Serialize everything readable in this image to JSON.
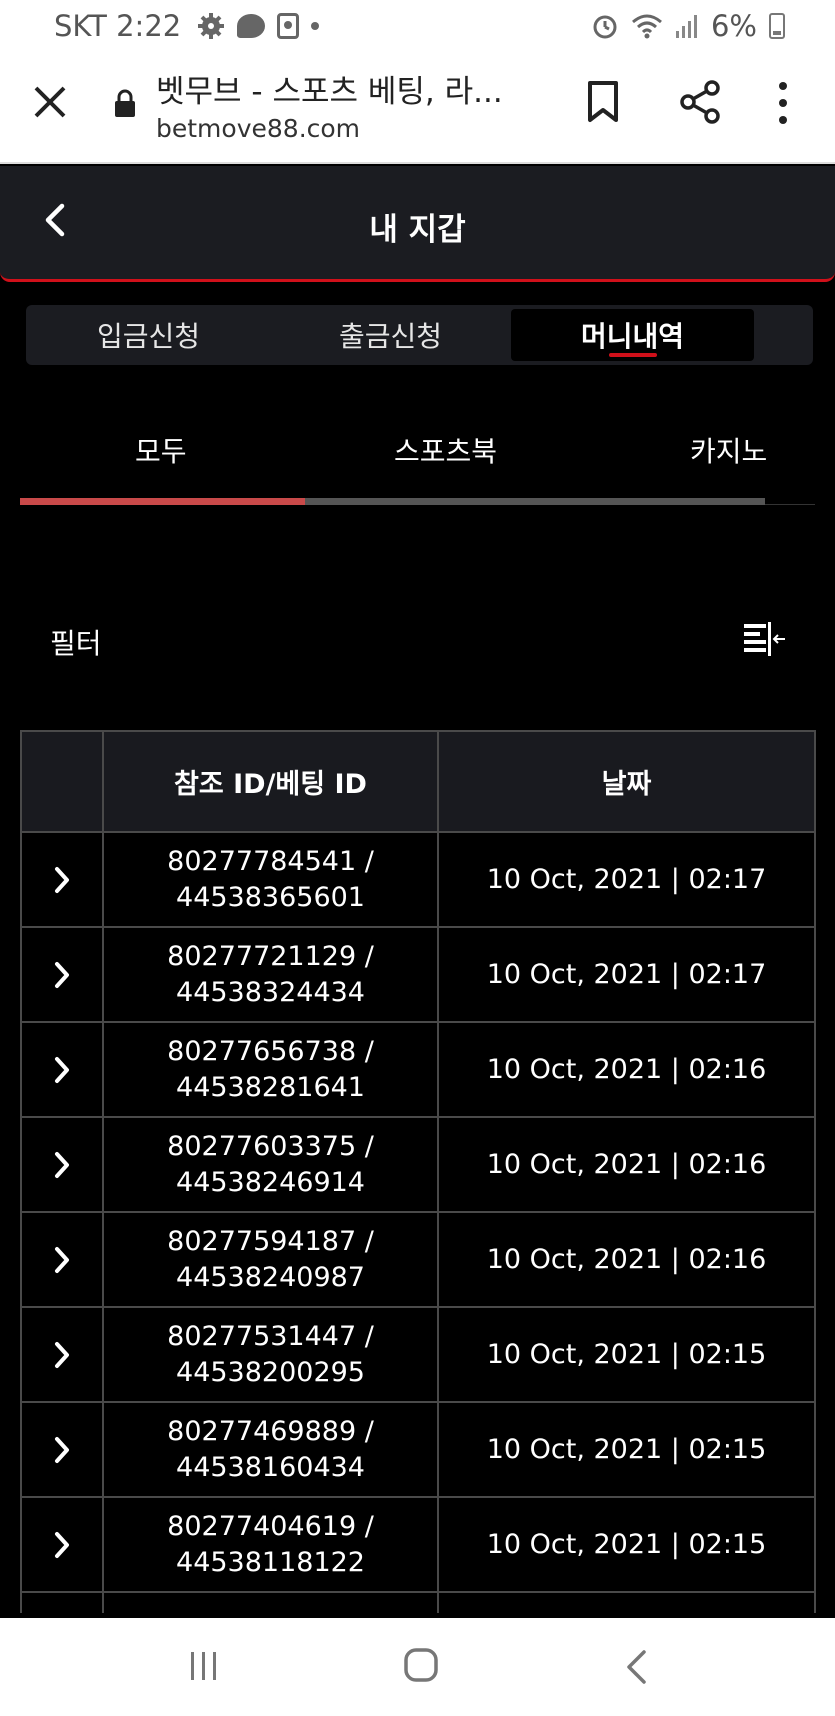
{
  "status_bar": {
    "carrier_time": "SKT 2:22",
    "battery": "6%"
  },
  "browser": {
    "title": "벳무브 - 스포츠 베팅, 라...",
    "url": "betmove88.com"
  },
  "header": {
    "title": "내 지갑"
  },
  "segment_tabs": [
    {
      "label": "입금신청",
      "active": false
    },
    {
      "label": "출금신청",
      "active": false
    },
    {
      "label": "머니내역",
      "active": true
    }
  ],
  "category_tabs": [
    {
      "label": "모두",
      "active": true
    },
    {
      "label": "스포츠북",
      "active": false
    },
    {
      "label": "카지노",
      "active": false
    }
  ],
  "filter": {
    "label": "필터"
  },
  "table": {
    "columns": [
      "",
      "참조 ID/베팅 ID",
      "날짜"
    ],
    "rows": [
      {
        "ref_id": "80277784541 /",
        "bet_id": "44538365601",
        "date": "10 Oct, 2021 | 02:17"
      },
      {
        "ref_id": "80277721129 /",
        "bet_id": "44538324434",
        "date": "10 Oct, 2021 | 02:17"
      },
      {
        "ref_id": "80277656738 /",
        "bet_id": "44538281641",
        "date": "10 Oct, 2021 | 02:16"
      },
      {
        "ref_id": "80277603375 /",
        "bet_id": "44538246914",
        "date": "10 Oct, 2021 | 02:16"
      },
      {
        "ref_id": "80277594187 /",
        "bet_id": "44538240987",
        "date": "10 Oct, 2021 | 02:16"
      },
      {
        "ref_id": "80277531447 /",
        "bet_id": "44538200295",
        "date": "10 Oct, 2021 | 02:15"
      },
      {
        "ref_id": "80277469889 /",
        "bet_id": "44538160434",
        "date": "10 Oct, 2021 | 02:15"
      },
      {
        "ref_id": "80277404619 /",
        "bet_id": "44538118122",
        "date": "10 Oct, 2021 | 02:15"
      }
    ]
  },
  "colors": {
    "accent": "#d0101a",
    "background": "#000000",
    "header_bg": "#1b1c21"
  }
}
